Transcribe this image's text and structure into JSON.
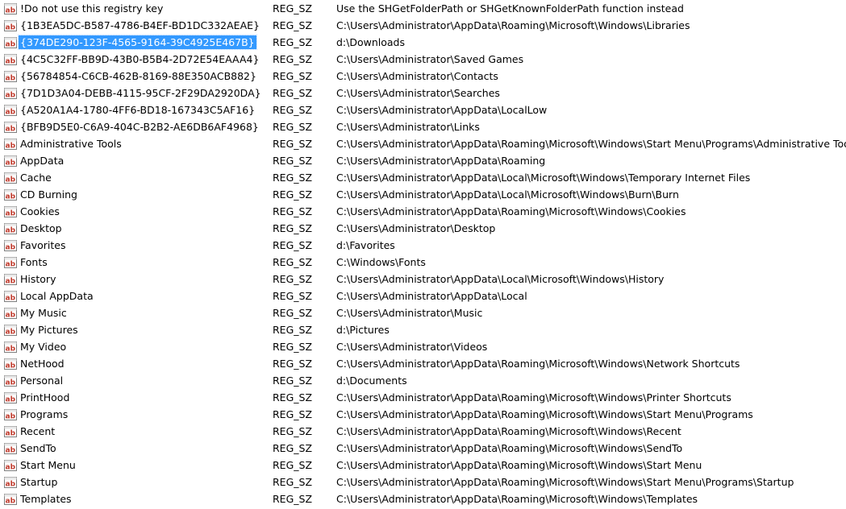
{
  "colors": {
    "selection_bg": "#3399ff",
    "selection_text": "#ffffff",
    "icon_red": "#c0392b"
  },
  "icon_name": "string-value-ab-icon",
  "rows": [
    {
      "name": "!Do not use this registry key",
      "type": "REG_SZ",
      "data": "Use the SHGetFolderPath or SHGetKnownFolderPath function instead",
      "selected": false
    },
    {
      "name": "{1B3EA5DC-B587-4786-B4EF-BD1DC332AEAE}",
      "type": "REG_SZ",
      "data": "C:\\Users\\Administrator\\AppData\\Roaming\\Microsoft\\Windows\\Libraries",
      "selected": false
    },
    {
      "name": "{374DE290-123F-4565-9164-39C4925E467B}",
      "type": "REG_SZ",
      "data": "d:\\Downloads",
      "selected": true
    },
    {
      "name": "{4C5C32FF-BB9D-43B0-B5B4-2D72E54EAAA4}",
      "type": "REG_SZ",
      "data": "C:\\Users\\Administrator\\Saved Games",
      "selected": false
    },
    {
      "name": "{56784854-C6CB-462B-8169-88E350ACB882}",
      "type": "REG_SZ",
      "data": "C:\\Users\\Administrator\\Contacts",
      "selected": false
    },
    {
      "name": "{7D1D3A04-DEBB-4115-95CF-2F29DA2920DA}",
      "type": "REG_SZ",
      "data": "C:\\Users\\Administrator\\Searches",
      "selected": false
    },
    {
      "name": "{A520A1A4-1780-4FF6-BD18-167343C5AF16}",
      "type": "REG_SZ",
      "data": "C:\\Users\\Administrator\\AppData\\LocalLow",
      "selected": false
    },
    {
      "name": "{BFB9D5E0-C6A9-404C-B2B2-AE6DB6AF4968}",
      "type": "REG_SZ",
      "data": "C:\\Users\\Administrator\\Links",
      "selected": false
    },
    {
      "name": "Administrative Tools",
      "type": "REG_SZ",
      "data": "C:\\Users\\Administrator\\AppData\\Roaming\\Microsoft\\Windows\\Start Menu\\Programs\\Administrative Tools",
      "selected": false
    },
    {
      "name": "AppData",
      "type": "REG_SZ",
      "data": "C:\\Users\\Administrator\\AppData\\Roaming",
      "selected": false
    },
    {
      "name": "Cache",
      "type": "REG_SZ",
      "data": "C:\\Users\\Administrator\\AppData\\Local\\Microsoft\\Windows\\Temporary Internet Files",
      "selected": false
    },
    {
      "name": "CD Burning",
      "type": "REG_SZ",
      "data": "C:\\Users\\Administrator\\AppData\\Local\\Microsoft\\Windows\\Burn\\Burn",
      "selected": false
    },
    {
      "name": "Cookies",
      "type": "REG_SZ",
      "data": "C:\\Users\\Administrator\\AppData\\Roaming\\Microsoft\\Windows\\Cookies",
      "selected": false
    },
    {
      "name": "Desktop",
      "type": "REG_SZ",
      "data": "C:\\Users\\Administrator\\Desktop",
      "selected": false
    },
    {
      "name": "Favorites",
      "type": "REG_SZ",
      "data": "d:\\Favorites",
      "selected": false
    },
    {
      "name": "Fonts",
      "type": "REG_SZ",
      "data": "C:\\Windows\\Fonts",
      "selected": false
    },
    {
      "name": "History",
      "type": "REG_SZ",
      "data": "C:\\Users\\Administrator\\AppData\\Local\\Microsoft\\Windows\\History",
      "selected": false
    },
    {
      "name": "Local AppData",
      "type": "REG_SZ",
      "data": "C:\\Users\\Administrator\\AppData\\Local",
      "selected": false
    },
    {
      "name": "My Music",
      "type": "REG_SZ",
      "data": "C:\\Users\\Administrator\\Music",
      "selected": false
    },
    {
      "name": "My Pictures",
      "type": "REG_SZ",
      "data": "d:\\Pictures",
      "selected": false
    },
    {
      "name": "My Video",
      "type": "REG_SZ",
      "data": "C:\\Users\\Administrator\\Videos",
      "selected": false
    },
    {
      "name": "NetHood",
      "type": "REG_SZ",
      "data": "C:\\Users\\Administrator\\AppData\\Roaming\\Microsoft\\Windows\\Network Shortcuts",
      "selected": false
    },
    {
      "name": "Personal",
      "type": "REG_SZ",
      "data": "d:\\Documents",
      "selected": false
    },
    {
      "name": "PrintHood",
      "type": "REG_SZ",
      "data": "C:\\Users\\Administrator\\AppData\\Roaming\\Microsoft\\Windows\\Printer Shortcuts",
      "selected": false
    },
    {
      "name": "Programs",
      "type": "REG_SZ",
      "data": "C:\\Users\\Administrator\\AppData\\Roaming\\Microsoft\\Windows\\Start Menu\\Programs",
      "selected": false
    },
    {
      "name": "Recent",
      "type": "REG_SZ",
      "data": "C:\\Users\\Administrator\\AppData\\Roaming\\Microsoft\\Windows\\Recent",
      "selected": false
    },
    {
      "name": "SendTo",
      "type": "REG_SZ",
      "data": "C:\\Users\\Administrator\\AppData\\Roaming\\Microsoft\\Windows\\SendTo",
      "selected": false
    },
    {
      "name": "Start Menu",
      "type": "REG_SZ",
      "data": "C:\\Users\\Administrator\\AppData\\Roaming\\Microsoft\\Windows\\Start Menu",
      "selected": false
    },
    {
      "name": "Startup",
      "type": "REG_SZ",
      "data": "C:\\Users\\Administrator\\AppData\\Roaming\\Microsoft\\Windows\\Start Menu\\Programs\\Startup",
      "selected": false
    },
    {
      "name": "Templates",
      "type": "REG_SZ",
      "data": "C:\\Users\\Administrator\\AppData\\Roaming\\Microsoft\\Windows\\Templates",
      "selected": false
    }
  ]
}
